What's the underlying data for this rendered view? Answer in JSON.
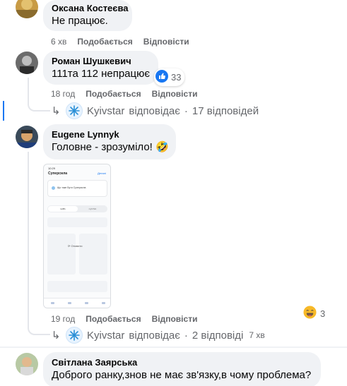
{
  "comments": [
    {
      "author": "Оксана Костеєва",
      "text": "Не працює.",
      "time": "6 хв",
      "like_label": "Подобається",
      "reply_label": "Відповісти"
    },
    {
      "author": "Роман Шушкевич",
      "text": "111та 112 непрацює",
      "time": "18 год",
      "like_label": "Подобається",
      "reply_label": "Відповісти",
      "reaction_count": "33",
      "reaction_icon": "like-icon",
      "replies": {
        "brand": "Kyivstar",
        "verb": "відповідає",
        "sep": "·",
        "count_text": "17 відповідей"
      }
    },
    {
      "author": "Eugene Lynnyk",
      "text": "Головне - зрозуміло! 🤣",
      "time": "19 год",
      "like_label": "Подобається",
      "reply_label": "Відповісти",
      "reaction_count": "3",
      "reaction_icon": "laugh-icon",
      "attachment": {
        "status_time": "10:29",
        "title": "Суперсила",
        "link": "Деталі",
        "card_text": "Що таке Бути Суперсила",
        "tab_left": "tariffs",
        "tab_right": "rightTab",
        "loading_text": "Оновити"
      },
      "replies": {
        "brand": "Kyivstar",
        "verb": "відповідає",
        "sep": "·",
        "count_text": "2 відповіді",
        "time": "7 хв"
      }
    },
    {
      "author": "Світлана Заярська",
      "text": "Доброго ранку,знов не має зв'язку,в чому проблема?"
    }
  ],
  "colors": {
    "accent": "#1877f2",
    "bubble": "#f0f2f5",
    "meta": "#65676b"
  }
}
